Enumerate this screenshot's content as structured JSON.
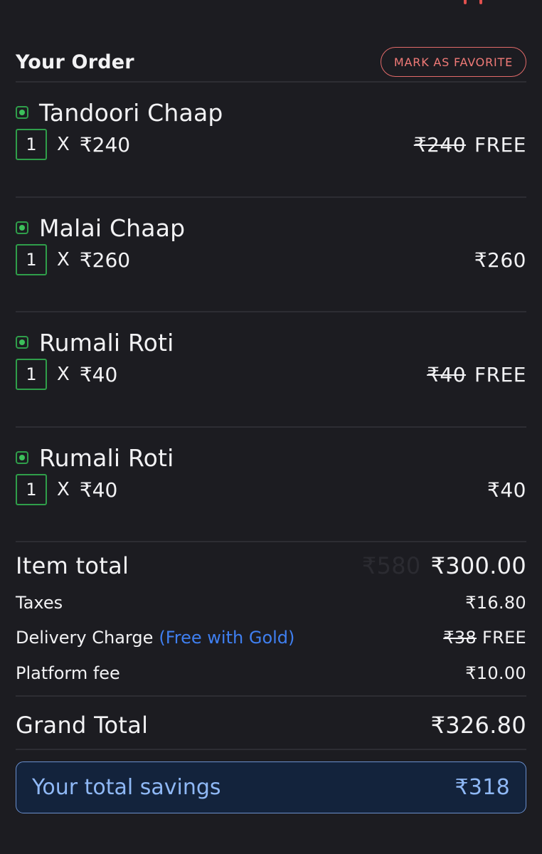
{
  "header": {
    "title": "Your Order",
    "favorite_label": "MARK AS FAVORITE"
  },
  "items": [
    {
      "name": "Tandoori Chaap",
      "qty": "1",
      "x": "X",
      "unit_price": "₹240",
      "original_price": "₹240",
      "price": "FREE"
    },
    {
      "name": "Malai Chaap",
      "qty": "1",
      "x": "X",
      "unit_price": "₹260",
      "original_price": "",
      "price": "₹260"
    },
    {
      "name": "Rumali Roti",
      "qty": "1",
      "x": "X",
      "unit_price": "₹40",
      "original_price": "₹40",
      "price": "FREE"
    },
    {
      "name": "Rumali Roti",
      "qty": "1",
      "x": "X",
      "unit_price": "₹40",
      "original_price": "",
      "price": "₹40"
    }
  ],
  "summary": {
    "item_total": {
      "label": "Item total",
      "original": "₹580",
      "value": "₹300.00"
    },
    "taxes": {
      "label": "Taxes",
      "value": "₹16.80"
    },
    "delivery": {
      "label": "Delivery Charge",
      "note": "(Free with Gold)",
      "original": "₹38",
      "value": "FREE"
    },
    "platform_fee": {
      "label": "Platform fee",
      "value": "₹10.00"
    },
    "grand_total": {
      "label": "Grand Total",
      "value": "₹326.80"
    }
  },
  "savings": {
    "label": "Your total savings",
    "value": "₹318"
  },
  "colors": {
    "background": "#1c1c21",
    "veg_green": "#2f9e4a",
    "accent_red": "#e16a69",
    "gold_blue": "#3f7ff0",
    "savings_bg": "#13233c"
  }
}
